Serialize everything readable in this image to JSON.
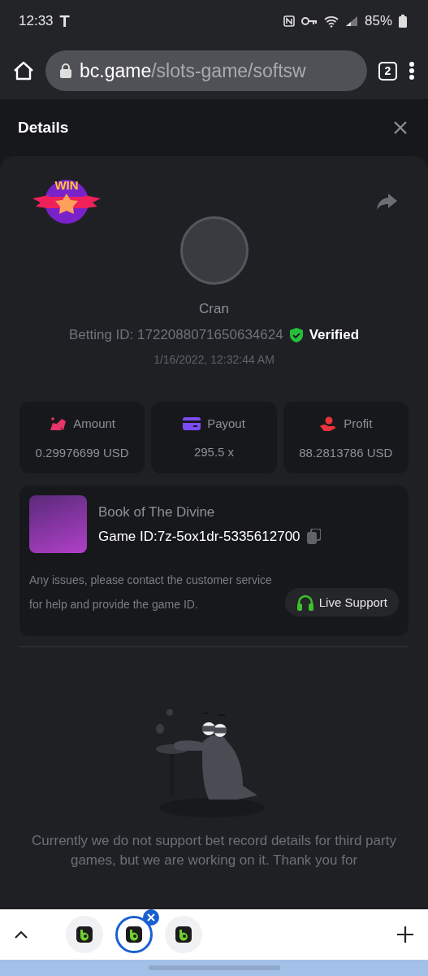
{
  "status_bar": {
    "time": "12:33",
    "carrier": "T",
    "battery": "85%"
  },
  "browser": {
    "url_host": "bc.game",
    "url_path": "/slots-game/softsw",
    "tab_count": "2"
  },
  "panel": {
    "title": "Details"
  },
  "bet": {
    "badge_text": "WIN",
    "player": "Cran",
    "betting_id": "Betting ID: 1722088071650634624",
    "verified": "Verified",
    "date": "1/16/2022, 12:32:44 AM"
  },
  "stats": [
    {
      "kind": "amount",
      "label": "Amount",
      "value": "0.29976699 USD",
      "color": "#e8346b"
    },
    {
      "kind": "payout",
      "label": "Payout",
      "value": "295.5 x",
      "color": "#7b4cf5"
    },
    {
      "kind": "profit",
      "label": "Profit",
      "value": "88.2813786 USD",
      "color": "#e8333a"
    }
  ],
  "game": {
    "title": "Book of The Divine",
    "game_id": "Game ID:7z-5ox1dr-5335612700",
    "notice": "Any issues, please contact the customer service for help and provide the game ID.",
    "support_button": "Live Support"
  },
  "empty_message": "Currently we do not support bet record details for third party games, but we are working on it. Thank you for",
  "tab_strip": [
    {
      "selected": false
    },
    {
      "selected": true
    },
    {
      "selected": false
    }
  ]
}
